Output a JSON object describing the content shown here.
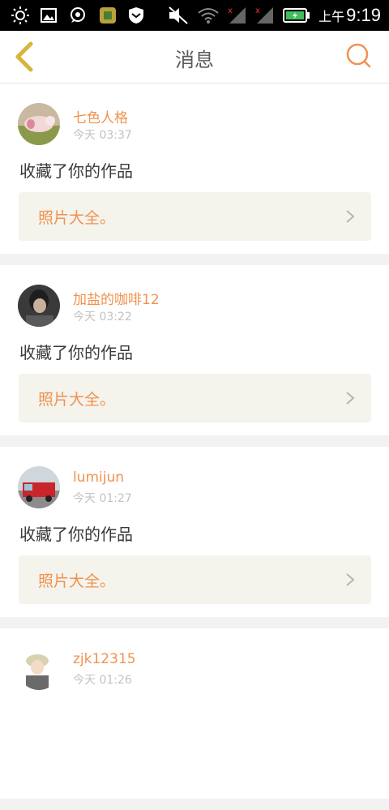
{
  "statusbar": {
    "ampm": "上午",
    "time": "9:19"
  },
  "header": {
    "title": "消息",
    "back_icon": "chevron-left-icon",
    "search_icon": "search-icon"
  },
  "colors": {
    "accent": "#f0924f",
    "back_icon": "#d7b53a",
    "card_box": "#f4f3ec",
    "time_text": "#c2c2c2"
  },
  "messages": [
    {
      "user": "七色人格",
      "time": "今天 03:37",
      "action": "收藏了你的作品",
      "work": "照片大全。"
    },
    {
      "user": "加盐的咖啡12",
      "time": "今天 03:22",
      "action": "收藏了你的作品",
      "work": "照片大全。"
    },
    {
      "user": "lumijun",
      "time": "今天 01:27",
      "action": "收藏了你的作品",
      "work": "照片大全。"
    },
    {
      "user": "zjk12315",
      "time": "今天 01:26",
      "action": "",
      "work": ""
    }
  ]
}
